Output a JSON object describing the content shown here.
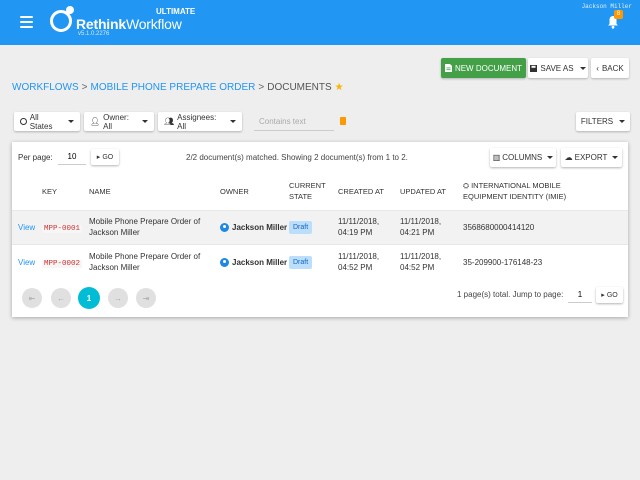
{
  "header": {
    "logo_brand": "Rethink",
    "logo_product": "Workflow",
    "edition": "ULTIMATE",
    "version": "v5.1.0.2276",
    "user_name": "Jackson Miller",
    "notification_count": "8",
    "menu_icon": "hamburger-menu-icon",
    "bell_icon": "bell-icon",
    "brand_color": "#2196f3"
  },
  "actions": {
    "new_document": "NEW DOCUMENT",
    "save_as": "SAVE AS",
    "back": "BACK"
  },
  "breadcrumb": {
    "items": [
      "WORKFLOWS",
      "MOBILE PHONE PREPARE ORDER",
      "DOCUMENTS"
    ],
    "separator": ">",
    "favorite_icon": "star-icon"
  },
  "filters": {
    "states": "All States",
    "owner": "Owner: All",
    "assignees": "Assignees: All",
    "search_placeholder": "Contains text",
    "filters_button": "FILTERS"
  },
  "table_controls": {
    "per_page_label": "Per page:",
    "per_page_value": "10",
    "go_label": "GO",
    "matched_text": "2/2 document(s) matched. Showing 2 document(s) from 1 to 2.",
    "columns_button": "COLUMNS",
    "export_button": "EXPORT"
  },
  "table": {
    "headers": {
      "key": "KEY",
      "name": "NAME",
      "owner": "OWNER",
      "current_state_1": "CURRENT",
      "current_state_2": "STATE",
      "created_at": "CREATED AT",
      "updated_at": "UPDATED AT",
      "imie_1": "INTERNATIONAL MOBILE",
      "imie_2": "EQUIPMENT IDENTITY (IMIE)"
    },
    "rows": [
      {
        "view": "View",
        "key": "MPP-0001",
        "name_1": "Mobile Phone Prepare Order of",
        "name_2": "Jackson Miller",
        "owner": "Jackson Miller",
        "state": "Draft",
        "created_1": "11/11/2018,",
        "created_2": "04:19 PM",
        "updated_1": "11/11/2018,",
        "updated_2": "04:21 PM",
        "imie": "3568680000414120"
      },
      {
        "view": "View",
        "key": "MPP-0002",
        "name_1": "Mobile Phone Prepare Order of",
        "name_2": "Jackson Miller",
        "owner": "Jackson Miller",
        "state": "Draft",
        "created_1": "11/11/2018,",
        "created_2": "04:52 PM",
        "updated_1": "11/11/2018,",
        "updated_2": "04:52 PM",
        "imie": "35-209900-176148-23"
      }
    ]
  },
  "pagination": {
    "first": "⇤",
    "prev": "←",
    "current_page": "1",
    "next": "→",
    "last": "⇥",
    "total_text": "1 page(s) total. Jump to page:",
    "jump_value": "1",
    "go_label": "GO",
    "active_color": "#00bcd4"
  }
}
